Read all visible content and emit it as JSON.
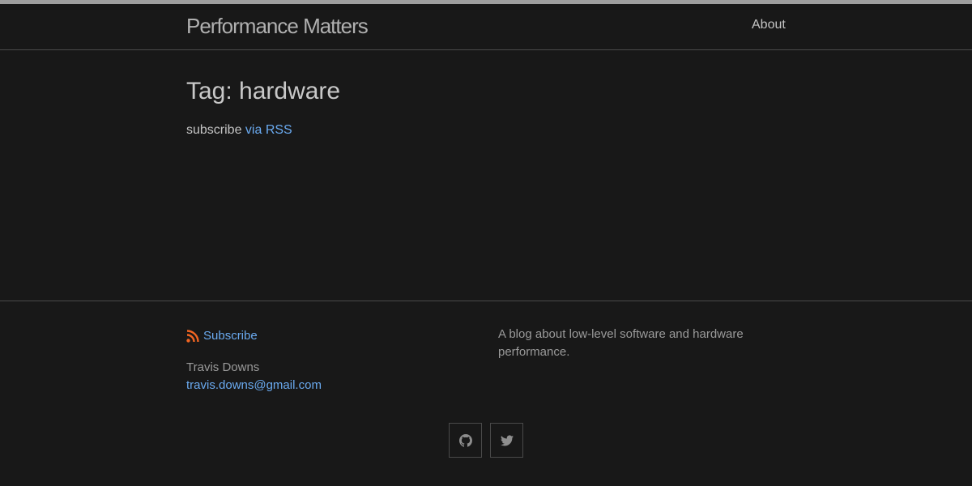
{
  "header": {
    "site_title": "Performance Matters",
    "nav": [
      {
        "label": "About"
      }
    ]
  },
  "main": {
    "heading": "Tag: hardware",
    "subscribe_prefix": "subscribe ",
    "rss_link_label": "via RSS"
  },
  "footer": {
    "subscribe_label": "Subscribe",
    "author_name": "Travis Downs",
    "author_email": "travis.downs@gmail.com",
    "description": "A blog about low-level software and hardware performance.",
    "social": [
      {
        "icon": "github-icon"
      },
      {
        "icon": "twitter-icon"
      }
    ]
  },
  "colors": {
    "background": "#181818",
    "top_bar": "#9e9e9e",
    "link": "#6aaaf0",
    "rss_orange": "#f26522",
    "border": "#4a4a4a"
  }
}
